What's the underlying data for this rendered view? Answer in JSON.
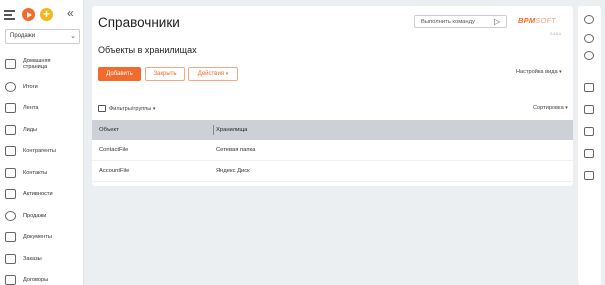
{
  "sidebar": {
    "workspace_selected": "Продажи",
    "items": [
      {
        "label": "Домашняя страница",
        "icon": "home-icon"
      },
      {
        "label": "Итоги",
        "icon": "dashboard-icon"
      },
      {
        "label": "Лента",
        "icon": "feed-icon"
      },
      {
        "label": "Лиды",
        "icon": "leads-icon"
      },
      {
        "label": "Контрагенты",
        "icon": "accounts-icon"
      },
      {
        "label": "Контакты",
        "icon": "contacts-icon"
      },
      {
        "label": "Активности",
        "icon": "flag-icon"
      },
      {
        "label": "Продажи",
        "icon": "opportunities-icon"
      },
      {
        "label": "Документы",
        "icon": "documents-icon"
      },
      {
        "label": "Заказы",
        "icon": "cart-icon"
      },
      {
        "label": "Договоры",
        "icon": "contracts-icon"
      }
    ]
  },
  "header": {
    "title": "Справочники",
    "command_placeholder": "Выполнить команду",
    "logo_main": "BPM",
    "logo_soft": "SOFT",
    "version": "2.4.6.4"
  },
  "page": {
    "subtitle": "Объекты в хранилищах",
    "add_label": "Добавить",
    "close_label": "Закрыть",
    "actions_label": "Действия",
    "view_settings_label": "Настройка вида",
    "filters_label": "Фильтры/группы",
    "sort_label": "Сортировка"
  },
  "table": {
    "columns": [
      "Объект",
      "Хранилища"
    ],
    "rows": [
      {
        "object": "ContactFile",
        "storage": "Сетевая папка"
      },
      {
        "object": "AccountFile",
        "storage": "Яндекс Диск"
      }
    ]
  },
  "colors": {
    "accent": "#f26a2c",
    "header_bg": "#cdd1d7",
    "background": "#eceff1"
  }
}
